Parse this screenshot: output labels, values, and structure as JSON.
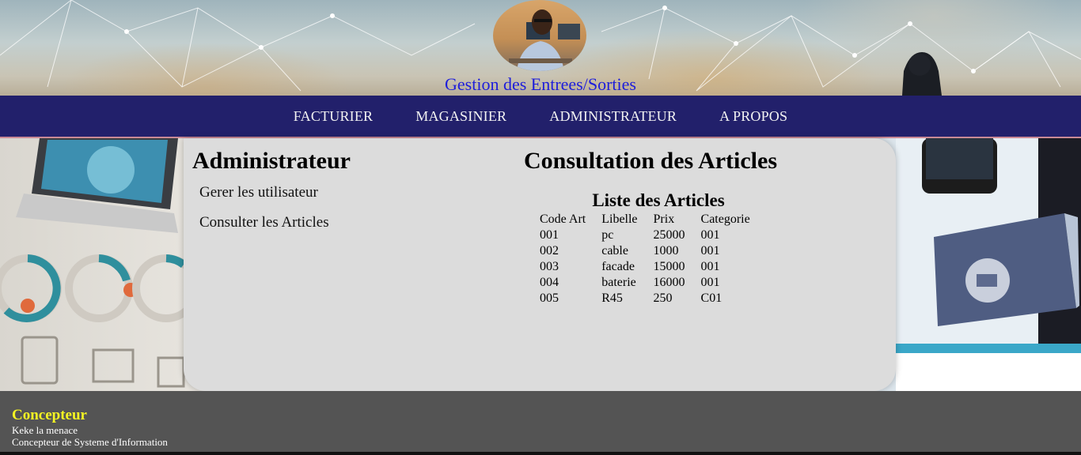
{
  "header": {
    "site_title": "Gestion des Entrees/Sorties"
  },
  "nav": {
    "items": [
      {
        "label": "FACTURIER"
      },
      {
        "label": "MAGASINIER"
      },
      {
        "label": "ADMINISTRATEUR"
      },
      {
        "label": "A PROPOS"
      }
    ]
  },
  "sidebar": {
    "title": "Administrateur",
    "links": [
      {
        "label": "Gerer les utilisateur"
      },
      {
        "label": "Consulter les Articles"
      }
    ]
  },
  "content": {
    "title": "Consultation des Articles",
    "list_title": "Liste des Articles",
    "table": {
      "headers": [
        "Code Art",
        "Libelle",
        "Prix",
        "Categorie"
      ],
      "rows": [
        [
          "001",
          "pc",
          "25000",
          "001"
        ],
        [
          "002",
          "cable",
          "1000",
          "001"
        ],
        [
          "003",
          "facade",
          "15000",
          "001"
        ],
        [
          "004",
          "baterie",
          "16000",
          "001"
        ],
        [
          "005",
          "R45",
          "250",
          "C01"
        ]
      ]
    }
  },
  "footer": {
    "title": "Concepteur",
    "lines": [
      "Keke la menace",
      "Concepteur de Systeme d'Information"
    ]
  },
  "colors": {
    "nav_bg": "#22206b",
    "title_blue": "#1d1ddb",
    "footer_bg": "#545454",
    "footer_title": "#f5f523",
    "panel_bg": "#dcdcdc"
  },
  "icons": [
    "profile-photo",
    "network-lines-decoration",
    "infographic-decoration",
    "mobile-decoration"
  ]
}
